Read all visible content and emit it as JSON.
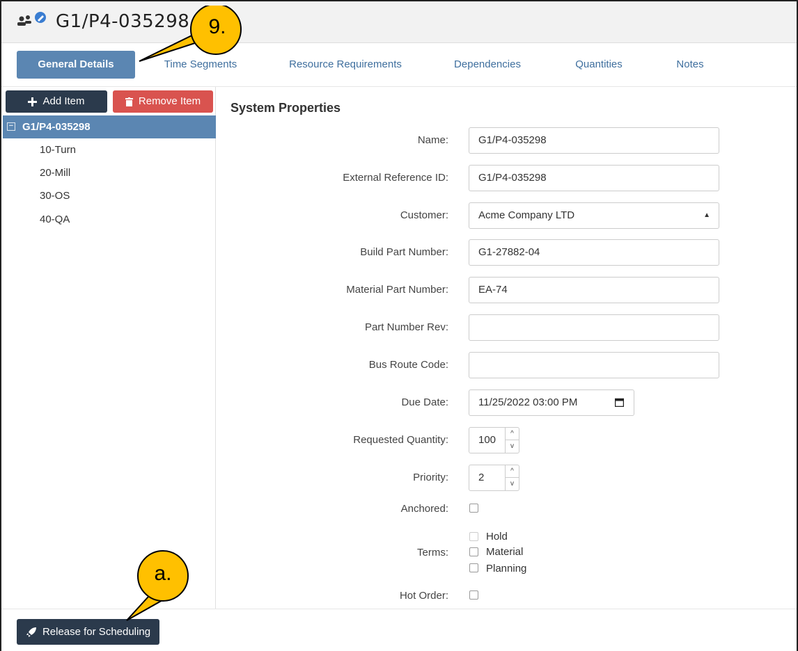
{
  "header": {
    "title": "G1/P4-035298",
    "icon": "group-edit-icon"
  },
  "callouts": {
    "tabs_marker": "9.",
    "release_marker": "a."
  },
  "tabs": [
    {
      "label": "General Details",
      "active": true
    },
    {
      "label": "Time Segments"
    },
    {
      "label": "Resource Requirements"
    },
    {
      "label": "Dependencies"
    },
    {
      "label": "Quantities"
    },
    {
      "label": "Notes"
    }
  ],
  "toolbar": {
    "add_label": "Add Item",
    "remove_label": "Remove Item"
  },
  "tree": {
    "root": "G1/P4-035298",
    "children": [
      "10-Turn",
      "20-Mill",
      "30-OS",
      "40-QA"
    ]
  },
  "form": {
    "section_title": "System Properties",
    "name": {
      "label": "Name:",
      "value": "G1/P4-035298"
    },
    "external_ref": {
      "label": "External Reference ID:",
      "value": "G1/P4-035298"
    },
    "customer": {
      "label": "Customer:",
      "value": "Acme Company LTD"
    },
    "build_part": {
      "label": "Build Part Number:",
      "value": "G1-27882-04"
    },
    "material_part": {
      "label": "Material Part Number:",
      "value": "EA-74"
    },
    "part_rev": {
      "label": "Part Number Rev:",
      "value": ""
    },
    "bus_route": {
      "label": "Bus Route Code:",
      "value": ""
    },
    "due_date": {
      "label": "Due Date:",
      "value": "11/25/2022 03:00 PM"
    },
    "requested_qty": {
      "label": "Requested Quantity:",
      "value": "100"
    },
    "priority": {
      "label": "Priority:",
      "value": "2"
    },
    "anchored": {
      "label": "Anchored:"
    },
    "terms": {
      "label": "Terms:",
      "options": [
        "Hold",
        "Material",
        "Planning"
      ]
    },
    "hot_order": {
      "label": "Hot Order:"
    }
  },
  "footer": {
    "release_label": "Release for Scheduling"
  },
  "colors": {
    "primary": "#5b86b2",
    "dark": "#2b3a4c",
    "danger": "#d9534f",
    "callout": "#ffc000"
  }
}
